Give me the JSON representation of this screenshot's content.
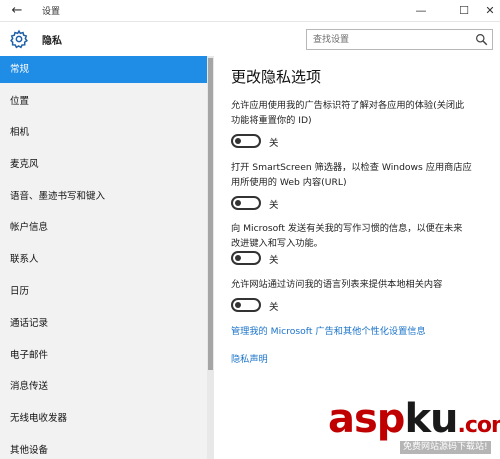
{
  "window": {
    "title": "设置",
    "back_glyph": "←",
    "minimize_glyph": "—",
    "maximize_glyph": "☐",
    "close_glyph": "✕"
  },
  "header": {
    "page_title": "隐私",
    "search_placeholder": "查找设置"
  },
  "sidebar": {
    "items": [
      {
        "label": "常规",
        "active": true
      },
      {
        "label": "位置"
      },
      {
        "label": "相机"
      },
      {
        "label": "麦克风"
      },
      {
        "label": "语音、墨迹书写和键入"
      },
      {
        "label": "帐户信息"
      },
      {
        "label": "联系人"
      },
      {
        "label": "日历"
      },
      {
        "label": "通话记录"
      },
      {
        "label": "电子邮件"
      },
      {
        "label": "消息传送"
      },
      {
        "label": "无线电收发器"
      },
      {
        "label": "其他设备"
      }
    ]
  },
  "main": {
    "heading": "更改隐私选项",
    "options": [
      {
        "description_lines": [
          "允许应用使用我的广告标识符了解对各应用的体验(关闭此",
          "功能将重置你的 ID)"
        ],
        "state": "关",
        "value": 0
      },
      {
        "description_lines": [
          "打开 SmartScreen 筛选器，以检查 Windows 应用商店应",
          "用所使用的 Web 内容(URL)"
        ],
        "state": "关",
        "value": 0
      },
      {
        "description_lines": [
          "向 Microsoft 发送有关我的写作习惯的信息，以便在未来",
          "改进键入和写入功能。"
        ],
        "state": "关",
        "value": 0
      },
      {
        "description_lines": [
          "允许网站通过访问我的语言列表来提供本地相关内容"
        ],
        "state": "关",
        "value": 0
      }
    ],
    "links": {
      "manage_ads": "管理我的 Microsoft 广告和其他个性化设置信息",
      "privacy_statement": "隐私声明"
    }
  },
  "watermark": {
    "brand_a": "asp",
    "brand_b": "ku",
    "brand_c": ".com",
    "subtitle": "免费网站源码下载站!"
  },
  "colors": {
    "accent": "#1f8ce6",
    "link": "#1a73c9",
    "sidebar_bg": "#f2f2f2",
    "watermark_red": "#c00000"
  }
}
